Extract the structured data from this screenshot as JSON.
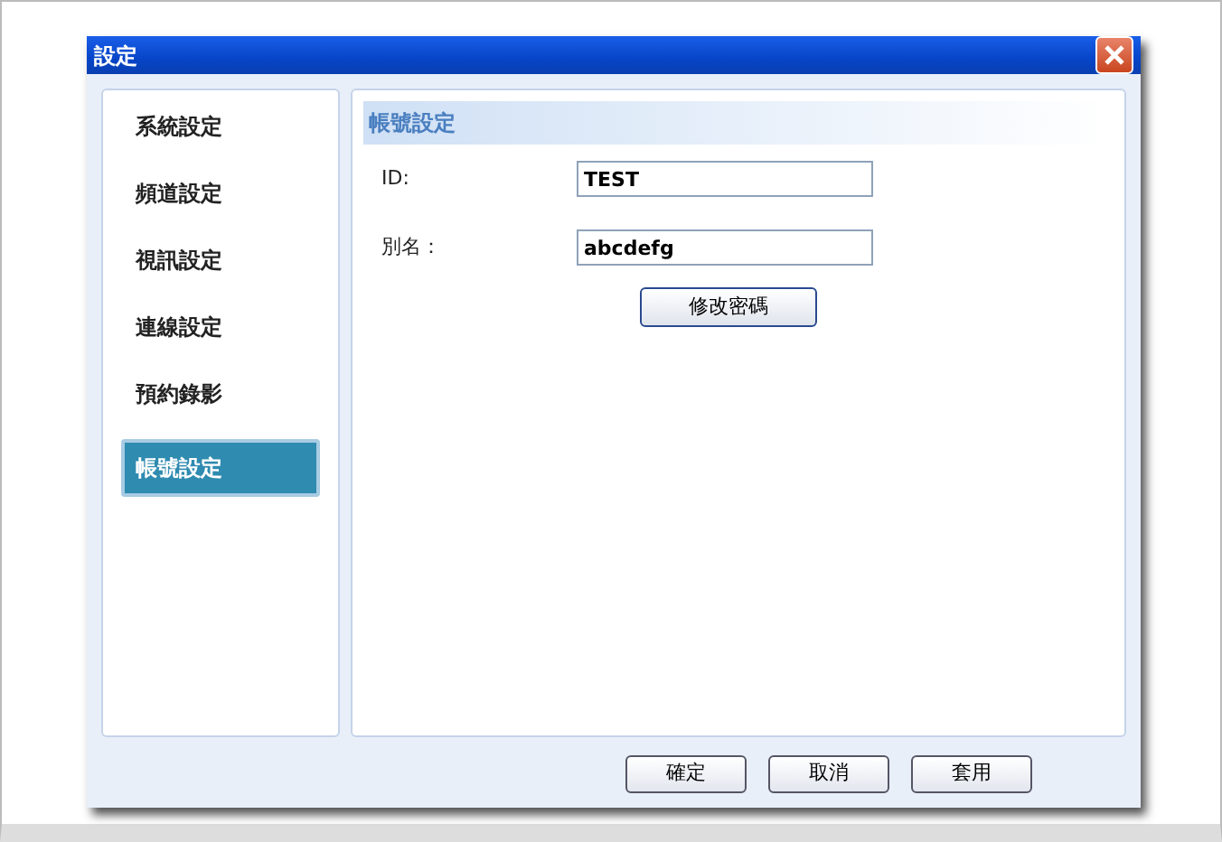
{
  "window": {
    "title": "設定"
  },
  "sidebar": {
    "items": [
      {
        "label": "系統設定",
        "selected": false
      },
      {
        "label": "頻道設定",
        "selected": false
      },
      {
        "label": "視訊設定",
        "selected": false
      },
      {
        "label": "連線設定",
        "selected": false
      },
      {
        "label": "預約錄影",
        "selected": false
      },
      {
        "label": "帳號設定",
        "selected": true
      }
    ]
  },
  "panel": {
    "title": "帳號設定",
    "fields": [
      {
        "label": "ID:",
        "value": "TEST"
      },
      {
        "label": "別名：",
        "value": "abcdefg"
      }
    ],
    "button": "修改密碼"
  },
  "buttons": [
    "確定",
    "取消",
    "套用"
  ]
}
